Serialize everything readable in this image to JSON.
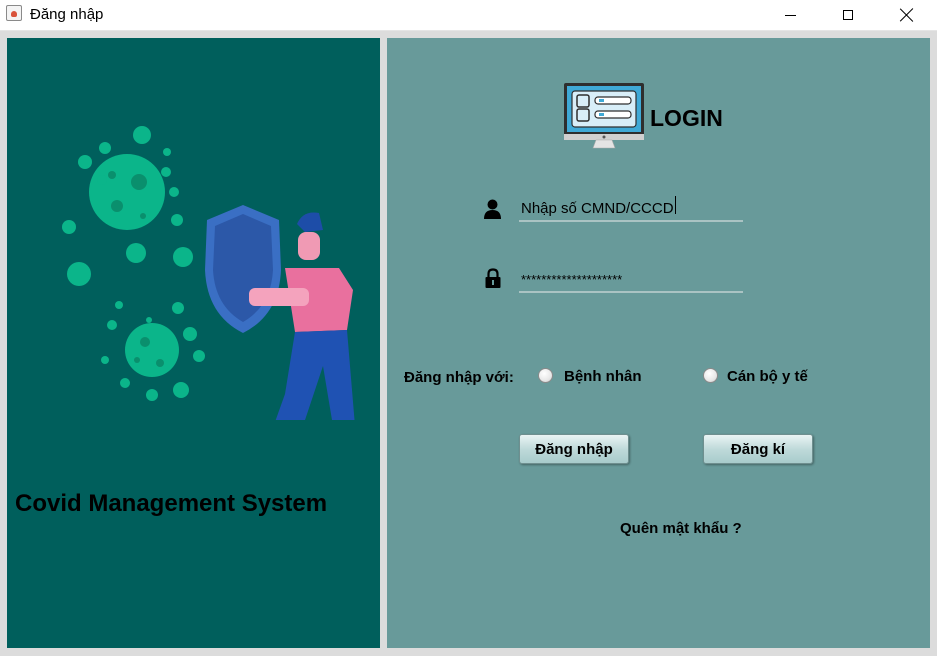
{
  "window": {
    "title": "Đăng nhập",
    "app_icon": "java-cup-icon",
    "controls": [
      "minimize-icon",
      "maximize-icon",
      "close-icon"
    ]
  },
  "left_panel": {
    "background": "#005f5c",
    "illustration": "virus-and-shield-illustration",
    "title": "Covid Management System"
  },
  "right_panel": {
    "background": "#689a9a",
    "heading": "LOGIN",
    "heading_icon": "computer-login-icon",
    "id_field": {
      "icon": "user-icon",
      "value": "Nhập số CMND/CCCD"
    },
    "password_field": {
      "icon": "lock-icon",
      "value": "********************"
    },
    "role": {
      "label": "Đăng nhập với:",
      "options": [
        "Bệnh nhân",
        "Cán bộ y tế"
      ]
    },
    "buttons": {
      "login": "Đăng nhập",
      "register": "Đăng kí"
    },
    "forgot_password": "Quên mật khẩu ?"
  }
}
